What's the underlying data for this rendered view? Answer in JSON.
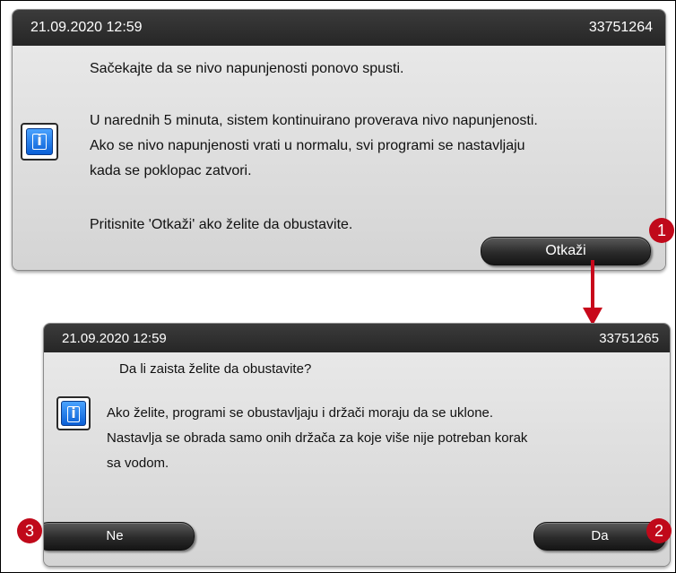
{
  "dialog1": {
    "datetime": "21.09.2020 12:59",
    "code": "33751264",
    "line1": "Sačekajte da se nivo napunjenosti ponovo spusti.",
    "para": [
      "U narednih 5 minuta, sistem kontinuirano proverava nivo napunjenosti.",
      "Ako se nivo napunjenosti vrati u normalu, svi programi se nastavljaju",
      "kada se poklopac zatvori."
    ],
    "line_last": "Pritisnite 'Otkaži' ako želite da obustavite.",
    "cancel_label": "Otkaži",
    "marker": "1"
  },
  "dialog2": {
    "datetime": "21.09.2020 12:59",
    "code": "33751265",
    "line1": "Da li zaista želite da obustavite?",
    "para": [
      "Ako želite, programi se obustavljaju i držači moraju da se uklone.",
      "Nastavlja se obrada samo onih držača za koje više nije potreban korak",
      "sa vodom."
    ],
    "no_label": "Ne",
    "yes_label": "Da",
    "marker_no": "3",
    "marker_yes": "2"
  },
  "icons": {
    "info": "info-icon",
    "arrow": "arrow-down-icon"
  },
  "colors": {
    "marker": "#c0091a",
    "titlebar": "#2b2b2b",
    "info_blue": "#1a73e8"
  }
}
